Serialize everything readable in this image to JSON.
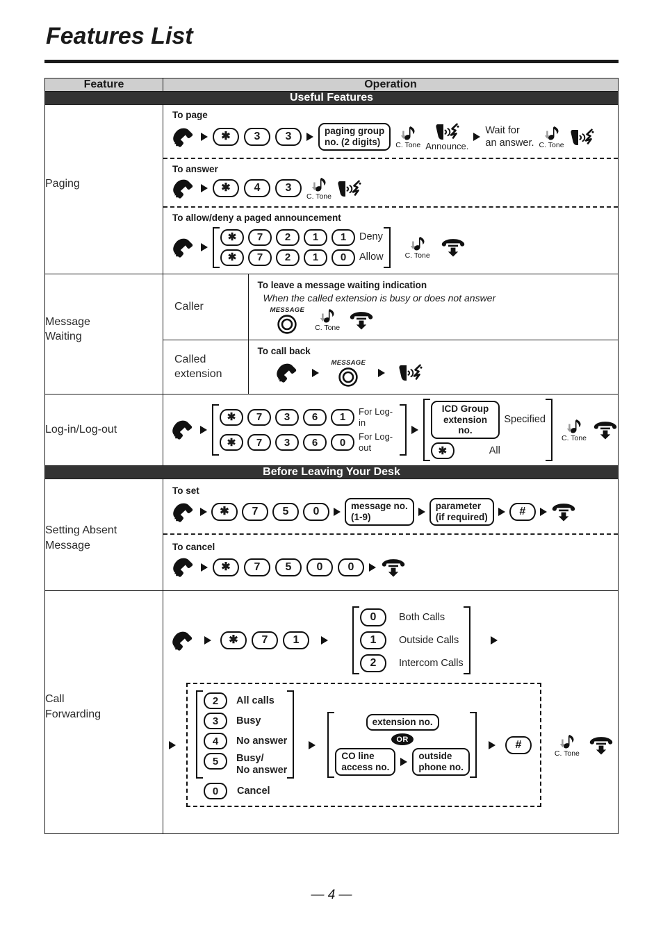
{
  "page": {
    "title": "Features List",
    "footer": "— 4 —"
  },
  "table": {
    "headers": {
      "feature": "Feature",
      "operation": "Operation"
    },
    "bands": {
      "useful": "Useful Features",
      "before_leaving": "Before Leaving Your Desk"
    }
  },
  "icons": {
    "offhook": "offhook-handset-icon",
    "onhook": "hangup-handset-icon",
    "talking": "talking-handset-icon",
    "ctone": "confirmation-tone-icon",
    "message_button": "message-button-icon",
    "message_caption": "MESSAGE",
    "arrow": "right-arrow-icon"
  },
  "labels": {
    "c_tone": "C. Tone",
    "or": "OR"
  },
  "features": {
    "paging": {
      "name": "Paging",
      "to_page": {
        "title": "To page",
        "keys": [
          "✱",
          "3",
          "3"
        ],
        "group_box": [
          "paging group",
          "no. (2 digits)"
        ],
        "announce": "Announce.",
        "wait": [
          "Wait for",
          "an answer."
        ]
      },
      "to_answer": {
        "title": "To answer",
        "keys": [
          "✱",
          "4",
          "3"
        ]
      },
      "allow_deny": {
        "title": "To allow/deny a paged announcement",
        "rows": [
          {
            "keys": [
              "✱",
              "7",
              "2",
              "1",
              "1"
            ],
            "label": "Deny"
          },
          {
            "keys": [
              "✱",
              "7",
              "2",
              "1",
              "0"
            ],
            "label": "Allow"
          }
        ]
      }
    },
    "message_waiting": {
      "name_lines": [
        "Message",
        "Waiting"
      ],
      "caller": {
        "role": "Caller",
        "title": "To leave a message waiting indication",
        "subtitle": "When the called extension is busy or does not answer"
      },
      "called_extension": {
        "role_lines": [
          "Called",
          "extension"
        ],
        "title": "To call back"
      }
    },
    "log_in_out": {
      "name": "Log-in/Log-out",
      "rows": [
        {
          "keys": [
            "✱",
            "7",
            "3",
            "6",
            "1"
          ],
          "label": "For Log-in"
        },
        {
          "keys": [
            "✱",
            "7",
            "3",
            "6",
            "0"
          ],
          "label": "For Log-out"
        }
      ],
      "target": {
        "box_lines": [
          "ICD Group",
          "extension no."
        ],
        "box_label": "Specified",
        "star_key": "✱",
        "star_label": "All"
      }
    },
    "absent_message": {
      "name_lines": [
        "Setting Absent",
        "Message"
      ],
      "to_set": {
        "title": "To set",
        "keys": [
          "✱",
          "7",
          "5",
          "0"
        ],
        "msg_box": [
          "message no.",
          "(1-9)"
        ],
        "param_box": [
          "parameter",
          "(if required)"
        ],
        "hash_key": "#"
      },
      "to_cancel": {
        "title": "To cancel",
        "keys": [
          "✱",
          "7",
          "5",
          "0",
          "0"
        ]
      }
    },
    "call_forwarding": {
      "name_lines": [
        "Call",
        "Forwarding"
      ],
      "keys": [
        "✱",
        "7",
        "1"
      ],
      "call_types": [
        {
          "key": "0",
          "label": "Both Calls"
        },
        {
          "key": "1",
          "label": "Outside Calls"
        },
        {
          "key": "2",
          "label": "Intercom Calls"
        }
      ],
      "modes": [
        {
          "key": "2",
          "label": "All calls"
        },
        {
          "key": "3",
          "label": "Busy"
        },
        {
          "key": "4",
          "label": "No answer"
        },
        {
          "key": "5",
          "label": "Busy/\nNo answer"
        }
      ],
      "cancel": {
        "key": "0",
        "label": "Cancel"
      },
      "destination": {
        "extension_box": "extension no.",
        "co_box": [
          "CO line",
          "access no."
        ],
        "outside_box": [
          "outside",
          "phone no."
        ]
      },
      "hash_key": "#"
    }
  }
}
